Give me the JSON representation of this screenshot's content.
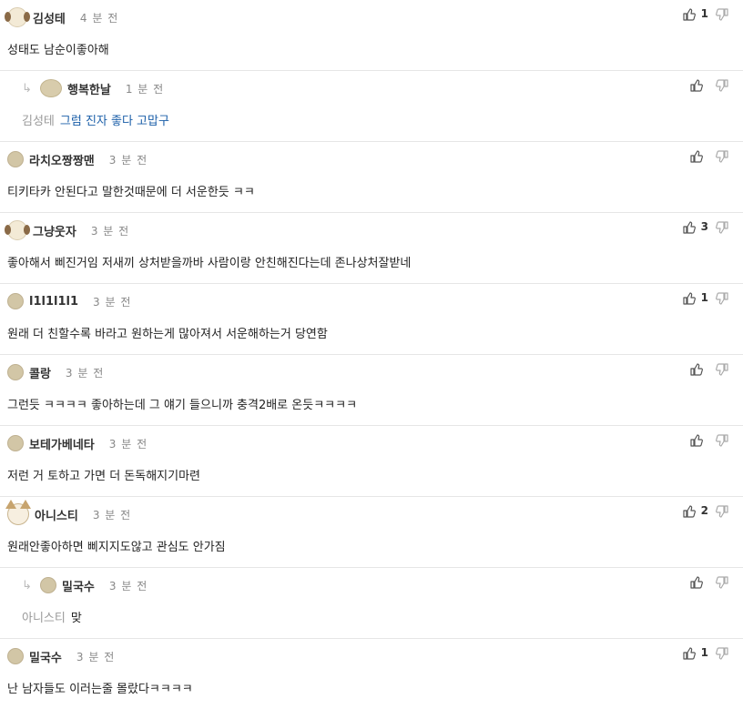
{
  "comments": [
    {
      "author": "김성테",
      "time": "4 분 전",
      "likes": "1",
      "text": "성태도 남순이좋아해",
      "avatar": "dog-avatar",
      "reply": false
    },
    {
      "author": "행복한날",
      "time": "1 분 전",
      "likes": "",
      "mention": "김성테",
      "text": "그럼 진자 좋다 고맙구",
      "avatar": "round-avatar",
      "reply": true
    },
    {
      "author": "라치오짱짱맨",
      "time": "3 분 전",
      "likes": "",
      "text": "티키타카 안된다고 말한것때문에 더 서운한듯 ㅋㅋ",
      "avatar": "plain-avatar",
      "reply": false
    },
    {
      "author": "그냥웃자",
      "time": "3 분 전",
      "likes": "3",
      "text": "좋아해서 삐진거임 저새끼 상처받을까바 사람이랑 안친해진다는데 존나상처잘받네",
      "avatar": "dog-avatar",
      "reply": false
    },
    {
      "author": "l1l1l1l1",
      "time": "3 분 전",
      "likes": "1",
      "text": "원래 더 친할수록 바라고 원하는게 많아져서 서운해하는거 당연함",
      "avatar": "plain-avatar",
      "reply": false
    },
    {
      "author": "콜랑",
      "time": "3 분 전",
      "likes": "",
      "text": "그런듯 ㅋㅋㅋㅋ 좋아하는데 그 얘기 들으니까 충격2배로 온듯ㅋㅋㅋㅋ",
      "avatar": "plain-avatar",
      "reply": false
    },
    {
      "author": "보테가베네타",
      "time": "3 분 전",
      "likes": "",
      "text": "저런 거 토하고 가면 더 돈독해지기마련",
      "avatar": "plain-avatar",
      "reply": false
    },
    {
      "author": "아니스티",
      "time": "3 분 전",
      "likes": "2",
      "text": "원래안좋아하면 삐지지도않고 관심도 안가짐",
      "avatar": "fox-avatar",
      "reply": false
    },
    {
      "author": "밀국수",
      "time": "3 분 전",
      "likes": "",
      "mention": "아니스티",
      "text": "맞",
      "avatar": "plain-avatar",
      "reply": true
    },
    {
      "author": "밀국수",
      "time": "3 분 전",
      "likes": "1",
      "text": "난 남자들도 이러는줄 몰랐다ㅋㅋㅋㅋ",
      "avatar": "plain-avatar",
      "reply": false
    }
  ],
  "icons": {
    "reply_arrow": "reply-arrow-icon",
    "thumb_up": "thumb-up-icon",
    "thumb_down": "thumb-down-icon"
  },
  "colors": {
    "reply_text": "#1a5ea8",
    "mention": "#999999",
    "divider": "#e6e6e6"
  }
}
